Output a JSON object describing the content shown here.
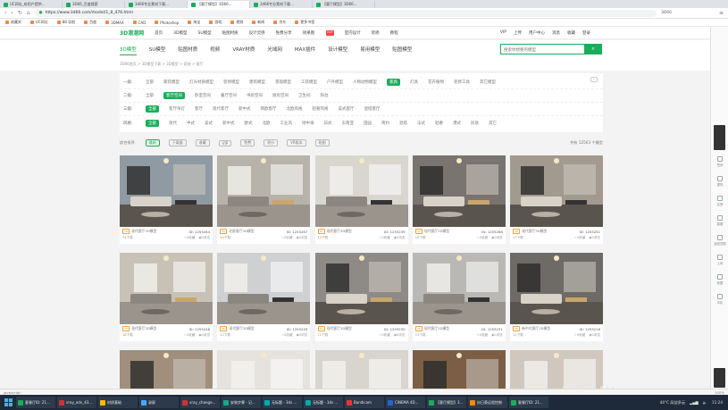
{
  "browser": {
    "tabs": [
      {
        "label": "UC网址_给用户提供..."
      },
      {
        "label": "3D66_百度搜索"
      },
      {
        "label": "3d66专业素材下载..."
      },
      {
        "label": "【客厅模型】3D66..."
      },
      {
        "label": "3d66专业素材下载..."
      },
      {
        "label": "【客厅模型】3D66..."
      }
    ],
    "url": "https://www.3d66.com/model/1_8_476.html",
    "url_right": "3D66",
    "bookmarks": [
      "收藏夹",
      "UC网址",
      "88 导航",
      "百度",
      "3DMAX",
      "CAD",
      "Photoshop",
      "淘宝",
      "游戏",
      "视频",
      "新闻",
      "京东",
      "更多书签"
    ]
  },
  "site": {
    "logo": "3D溜溜网",
    "nav": [
      "首页",
      "3D模型",
      "SU模型",
      "贴图材质",
      "设计灵感",
      "免费分享",
      "效果图",
      "室内设计",
      "装修",
      "教程"
    ],
    "nav_hot": "HOT",
    "user": [
      "VIP",
      "上传",
      "用户中心",
      "消息",
      "收藏",
      "登录"
    ],
    "cat_tabs": [
      "3D模型",
      "SU模型",
      "贴图材质",
      "视频",
      "VRAY材质",
      "光域网",
      "MAX插件",
      "设计模型",
      "易用模型",
      "贴图模型"
    ],
    "search_placeholder": "搜索你想要的模型",
    "breadcrumb": "3D66首页 > 3D模型下载 > 3D模型 > 家装 > 客厅",
    "filters": [
      {
        "label": "一级:",
        "opts": [
          "全部",
          "家装模型",
          "灯光材质模型",
          "装修模型",
          "建筑模型",
          "景观模型",
          "工装模型",
          "户外模型",
          "人物动物模型",
          "家具",
          "灯具",
          "花卉植物",
          "装修工具",
          "其它模型"
        ],
        "on": "家具"
      },
      {
        "label": "二级:",
        "opts": [
          "全部",
          "客厅空间",
          "卧室空间",
          "餐厅空间",
          "书房空间",
          "厨房空间",
          "卫生间",
          "阳台"
        ],
        "on": "客厅空间"
      },
      {
        "label": "三级:",
        "opts": [
          "全部",
          "客厅吊灯",
          "客厅",
          "现代客厅",
          "新中式",
          "简欧客厅",
          "北欧风格",
          "轻奢风格",
          "美式客厅",
          "混搭客厅"
        ],
        "on": "全部"
      },
      {
        "label": "风格:",
        "opts": [
          "全部",
          "现代",
          "中式",
          "美式",
          "新中式",
          "欧式",
          "北欧",
          "工业风",
          "地中海",
          "日式",
          "东南亚",
          "田园",
          "简约",
          "混搭",
          "法式",
          "轻奢",
          "港式",
          "民族",
          "其它"
        ],
        "on": "全部"
      }
    ],
    "sort": {
      "label": "综合排序",
      "opts": [
        "最新",
        "下载量",
        "收藏",
        "VIP",
        "免费",
        "积分",
        "VR版本",
        "贴图"
      ],
      "count": "共有 12563 个模型"
    }
  },
  "cards": [
    {
      "id": "ID: 1255264",
      "title": "现代客厅3D模型",
      "tag": "3D",
      "foot_left": "24下载",
      "likes": "0收藏",
      "views": "0浏览",
      "bg": "#8f9aa2"
    },
    {
      "id": "ID: 1255267",
      "title": "北欧客厅3D模型",
      "tag": "3D",
      "foot_left": "10下载",
      "likes": "0收藏",
      "views": "0浏览",
      "bg": "#b8b3aa"
    },
    {
      "id": "ID: 1255239",
      "title": "现代客厅3D模型",
      "tag": "3D",
      "foot_left": "12下载",
      "likes": "0收藏",
      "views": "0浏览",
      "bg": "#d9d6d0"
    },
    {
      "id": "ID: 1255268",
      "title": "现代客厅3D模型",
      "tag": "3D",
      "foot_left": "16下载",
      "likes": "0收藏",
      "views": "0浏览",
      "bg": "#7a7470"
    },
    {
      "id": "ID: 1255251",
      "title": "现代客厅3D模型",
      "tag": "3D",
      "foot_left": "17下载",
      "likes": "0收藏",
      "views": "0浏览",
      "bg": "#a29a8e"
    },
    {
      "id": "ID: 1255246",
      "title": "现代客厅3D模型",
      "tag": "3D",
      "foot_left": "18下载",
      "likes": "0收藏",
      "views": "0浏览",
      "bg": "#c8c2b6"
    },
    {
      "id": "ID: 1255249",
      "title": "现代客厅3D模型",
      "tag": "3D",
      "foot_left": "10下载",
      "likes": "0收藏",
      "views": "0浏览",
      "bg": "#cfd0d2"
    },
    {
      "id": "ID: 1255230",
      "title": "现代客厅3D模型",
      "tag": "3D",
      "foot_left": "11下载",
      "likes": "0收藏",
      "views": "0浏览",
      "bg": "#8e8a86"
    },
    {
      "id": "ID: 1255231",
      "title": "现代客厅3D模型",
      "tag": "3D",
      "foot_left": "13下载",
      "likes": "0收藏",
      "views": "0浏览",
      "bg": "#b9b8b4"
    },
    {
      "id": "ID: 1255216",
      "title": "新中式客厅3D模型",
      "tag": "3D",
      "foot_left": "12下载",
      "likes": "0收藏",
      "views": "0浏览",
      "bg": "#6e6a66"
    },
    {
      "id": "",
      "title": "",
      "tag": "",
      "foot_left": "",
      "likes": "",
      "views": "",
      "bg": "#9f8f7c"
    },
    {
      "id": "",
      "title": "",
      "tag": "",
      "foot_left": "",
      "likes": "",
      "views": "",
      "bg": "#e6e3df"
    },
    {
      "id": "",
      "title": "",
      "tag": "",
      "foot_left": "",
      "likes": "",
      "views": "",
      "bg": "#d8d4ce"
    },
    {
      "id": "",
      "title": "",
      "tag": "",
      "foot_left": "",
      "likes": "",
      "views": "",
      "bg": "#7b5e45"
    },
    {
      "id": "",
      "title": "",
      "tag": "",
      "foot_left": "",
      "likes": "",
      "views": "",
      "bg": "#d0c7bf"
    }
  ],
  "side_tools": [
    "签到",
    "提现",
    "反馈",
    "客服",
    "返回顶部",
    "上传",
    "收藏",
    "手机"
  ],
  "status_bar": {
    "left": "javascript:",
    "right": "100%"
  },
  "taskbar": {
    "items": [
      {
        "label": "客餐厅ID: 21...",
        "color": "#1aad5a"
      },
      {
        "label": "vray_adv_43...",
        "color": "#c33"
      },
      {
        "label": "材质基础",
        "color": "#fb0"
      },
      {
        "label": "录屏",
        "color": "#4af"
      },
      {
        "label": "vray_change...",
        "color": "#c33"
      },
      {
        "label": "安装步骤 - 记...",
        "color": "#1a8"
      },
      {
        "label": "无标题 - 3ds ...",
        "color": "#0aa"
      },
      {
        "label": "无标题 - 3ds ...",
        "color": "#0aa"
      },
      {
        "label": "Bandicam",
        "color": "#e33"
      },
      {
        "label": "CINEMA 4D...",
        "color": "#26c"
      },
      {
        "label": "【客厅模型】3...",
        "color": "#1aad5a"
      },
      {
        "label": "向日葵远程控制",
        "color": "#f80"
      },
      {
        "label": "客餐厅ID: 21...",
        "color": "#1aad5a"
      }
    ],
    "weather": "44°C 局部多云",
    "time": "11:24"
  },
  "watermark": "bilibili",
  "colors": {
    "accent": "#1aad5a",
    "tag": "#f0a040"
  }
}
